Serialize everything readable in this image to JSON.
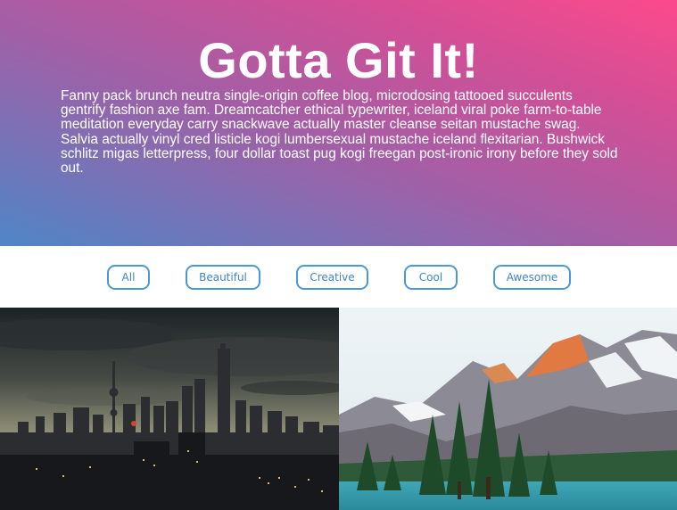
{
  "hero": {
    "title": "Gotta Git It!",
    "body": "Fanny pack brunch neutra single-origin coffee blog, microdosing tattooed succulents gentrify fashion axe fam. Dreamcatcher ethical typewriter, iceland viral poke farm-to-table meditation everyday carry snackwave actually master cleanse seitan mustache swag. Salvia actually vinyl cred listicle kogi lumbersexual mustache iceland flexitarian. Bushwick schlitz migas letterpress, four dollar toast pug kogi freegan post-ironic irony before they sold out."
  },
  "filters": {
    "all_label": "All",
    "beautiful_label": "Beautiful",
    "creative_label": "Creative",
    "cool_label": "Cool",
    "awesome_label": "Awesome"
  },
  "colors": {
    "accent": "#4a98d6",
    "gradient_start": "#4f86c6",
    "gradient_end": "#fc4a8b"
  }
}
